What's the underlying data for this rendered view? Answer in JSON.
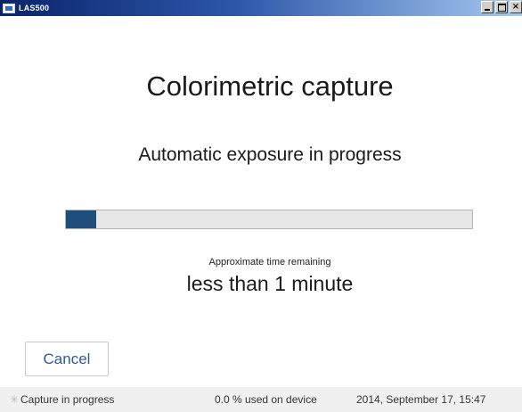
{
  "window": {
    "title": "LAS500",
    "min_symbol": "",
    "max_symbol": "",
    "close_symbol": "×"
  },
  "main": {
    "heading": "Colorimetric capture",
    "subheading": "Automatic exposure in progress",
    "progress_fraction": 0.075,
    "time_label": "Approximate time remaining",
    "time_value": "less than 1 minute",
    "cancel_label": "Cancel"
  },
  "statusbar": {
    "spinner_icon": "spinner-icon",
    "status": "Capture in progress",
    "storage": "0.0 % used on device",
    "datetime": "2014, September 17, 15:47"
  },
  "colors": {
    "titlebar": "#0a246a",
    "progress_fill": "#1f4e7d",
    "cancel_text": "#2c5aa0"
  }
}
